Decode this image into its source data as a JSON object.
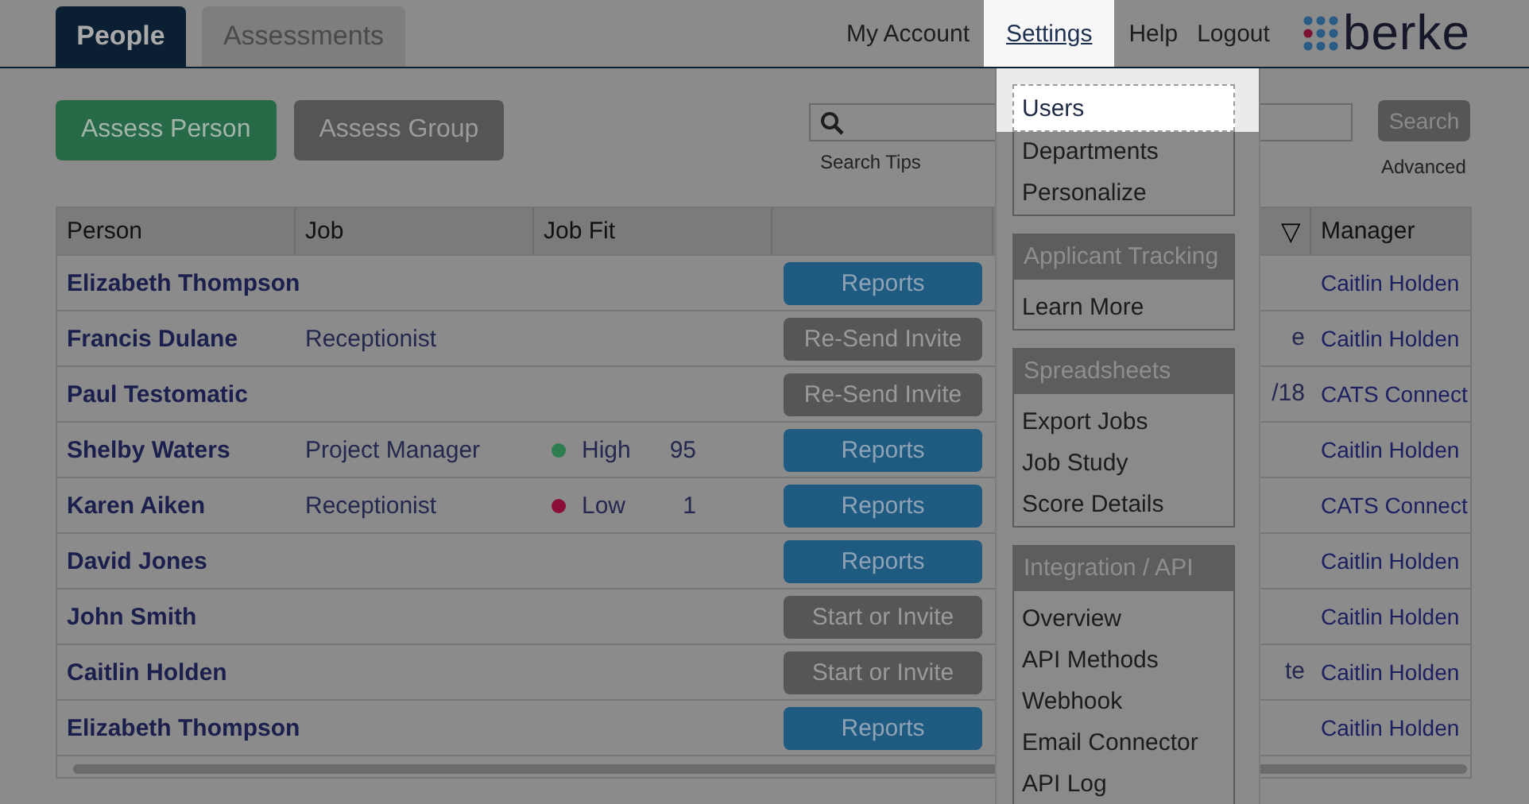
{
  "tabs": [
    {
      "label": "People",
      "selected": true
    },
    {
      "label": "Assessments",
      "selected": false
    }
  ],
  "nav_links": [
    {
      "label": "My Account",
      "highlighted": false
    },
    {
      "label": "Settings",
      "highlighted": true
    },
    {
      "label": "Help",
      "highlighted": false
    },
    {
      "label": "Logout",
      "highlighted": false
    }
  ],
  "logo": {
    "text": "berke"
  },
  "actions": [
    {
      "label": "Assess Person",
      "kind": "primary"
    },
    {
      "label": "Assess Group",
      "kind": "secondary"
    }
  ],
  "search": {
    "button": "Search",
    "tips_link": "Search Tips",
    "advanced_link": "Advanced"
  },
  "table": {
    "columns": {
      "person": "Person",
      "job": "Job",
      "job_fit": "Job Fit",
      "column_5": "▽",
      "manager": "Manager"
    },
    "rows": [
      {
        "person": "Elizabeth Thompson",
        "action": {
          "label": "Reports",
          "kind": "reports"
        },
        "manager": "Caitlin Holden"
      },
      {
        "person": "Francis Dulane",
        "job": "Receptionist",
        "action": {
          "label": "Re-Send Invite",
          "kind": "invite"
        },
        "column_5": "e",
        "manager": "Caitlin Holden"
      },
      {
        "person": "Paul Testomatic",
        "action": {
          "label": "Re-Send Invite",
          "kind": "invite"
        },
        "column_5": "/18",
        "manager": "CATS Connect"
      },
      {
        "person": "Shelby Waters",
        "job": "Project Manager",
        "job_fit": {
          "label": "High",
          "score": "95",
          "color": "#2e7d4f"
        },
        "action": {
          "label": "Reports",
          "kind": "reports"
        },
        "manager": "Caitlin Holden"
      },
      {
        "person": "Karen Aiken",
        "job": "Receptionist",
        "job_fit": {
          "label": "Low",
          "score": "1",
          "color": "#8a0e36"
        },
        "action": {
          "label": "Reports",
          "kind": "reports"
        },
        "manager": "CATS Connect"
      },
      {
        "person": "David Jones",
        "action": {
          "label": "Reports",
          "kind": "reports"
        },
        "manager": "Caitlin Holden"
      },
      {
        "person": "John Smith",
        "action": {
          "label": "Start or Invite",
          "kind": "invite"
        },
        "manager": "Caitlin Holden"
      },
      {
        "person": "Caitlin Holden",
        "action": {
          "label": "Start or Invite",
          "kind": "invite"
        },
        "column_5": "te",
        "manager": "Caitlin Holden"
      },
      {
        "person": "Elizabeth Thompson",
        "action": {
          "label": "Reports",
          "kind": "reports"
        },
        "manager": "Caitlin Holden"
      }
    ]
  },
  "settings_menu": {
    "sections": [
      {
        "items": [
          {
            "label": "Users",
            "selected": true
          },
          {
            "label": "Departments",
            "selected": false
          },
          {
            "label": "Personalize",
            "selected": false
          }
        ]
      },
      {
        "title": "Applicant Tracking",
        "items": [
          {
            "label": "Learn More",
            "selected": false
          }
        ]
      },
      {
        "title": "Spreadsheets",
        "items": [
          {
            "label": "Export Jobs",
            "selected": false
          },
          {
            "label": "Job Study",
            "selected": false
          },
          {
            "label": "Score Details",
            "selected": false
          }
        ]
      },
      {
        "title": "Integration / API",
        "items": [
          {
            "label": "Overview",
            "selected": false
          },
          {
            "label": "API Methods",
            "selected": false
          },
          {
            "label": "Webhook",
            "selected": false
          },
          {
            "label": "Email Connector",
            "selected": false
          },
          {
            "label": "API Log",
            "selected": false
          }
        ]
      }
    ]
  }
}
